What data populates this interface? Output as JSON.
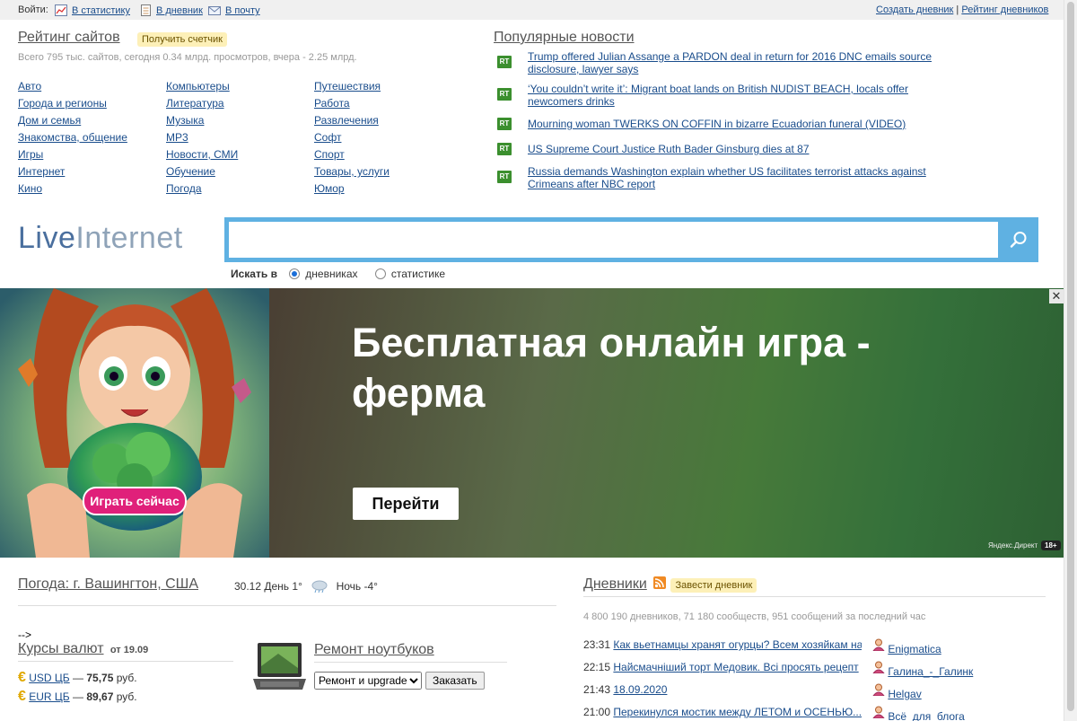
{
  "topbar": {
    "login": "Войти:",
    "stats": "В статистику",
    "diary": "В дневник",
    "mail": "В почту",
    "create": "Создать дневник",
    "sep": "|",
    "rating": "Рейтинг дневников"
  },
  "rating": {
    "title": "Рейтинг сайтов",
    "counter_btn": "Получить счетчик",
    "stats": "Всего 795 тыс. сайтов, сегодня 0.34 млрд. просмотров, вчера - 2.25 млрд.",
    "categories": [
      [
        "Авто",
        "Города и регионы",
        "Дом и семья",
        "Знакомства, общение",
        "Игры",
        "Интернет",
        "Кино"
      ],
      [
        "Компьютеры",
        "Литература",
        "Музыка",
        "MP3",
        "Новости, СМИ",
        "Обучение",
        "Погода"
      ],
      [
        "Путешествия",
        "Работа",
        "Развлечения",
        "Софт",
        "Спорт",
        "Товары, услуги",
        "Юмор"
      ]
    ]
  },
  "news": {
    "title": "Популярные новости",
    "source_label": "RT",
    "items": [
      "Trump offered Julian Assange a PARDON deal in return for 2016 DNC emails source disclosure, lawyer says",
      "‘You couldn’t write it’: Migrant boat lands on British NUDIST BEACH, locals offer newcomers drinks",
      "Mourning woman TWERKS ON COFFIN in bizarre Ecuadorian funeral (VIDEO)",
      "US Supreme Court Justice Ruth Bader Ginsburg dies at 87",
      "Russia demands Washington explain whether US facilitates terrorist attacks against Crimeans after NBC report"
    ]
  },
  "logo": {
    "part1": "Live",
    "part2": "Internet"
  },
  "search": {
    "value": "",
    "label": "Искать в",
    "option_diaries": "дневниках",
    "option_stats": "статистике",
    "selected": "дневниках"
  },
  "ad": {
    "title": "Бесплатная онлайн игра - ферма",
    "image_button": "Играть сейчас",
    "go_button": "Перейти",
    "close": "✕",
    "provider": "Яндекс.Директ",
    "age": "18+"
  },
  "weather": {
    "title": "Погода: г. Вашингтон, США",
    "date": "30.12",
    "day": "День 1°",
    "night": "Ночь -4°"
  },
  "stray_text": "-->",
  "rates": {
    "title": "Курсы валют",
    "date": "от 19.09",
    "items": [
      {
        "code": "USD ЦБ",
        "dash": "—",
        "value": "75,75",
        "unit": "руб."
      },
      {
        "code": "EUR ЦБ",
        "dash": "—",
        "value": "89,67",
        "unit": "руб."
      }
    ]
  },
  "repair": {
    "title": "Ремонт ноутбуков",
    "select_value": "Ремонт и upgrade",
    "order_button": "Заказать"
  },
  "diaries": {
    "title": "Дневники",
    "create_btn": "Завести дневник",
    "stats": "4 800 190 дневников, 71 180 сообществ, 951 сообщений за последний час",
    "posts": [
      {
        "time": "23:31",
        "title": "Как вьетнамцы хранят огурцы? Всем хозяйкам на",
        "user": "Enigmatica"
      },
      {
        "time": "22:15",
        "title": "Найсмачніший торт Медовик. Всі просять рецепт",
        "user": "Галина_-_Галинк"
      },
      {
        "time": "21:43",
        "title": "18.09.2020",
        "user": "Helgav"
      },
      {
        "time": "21:00",
        "title": "Перекинулся мостик между ЛЕТОМ и ОСЕНЬЮ...",
        "user": "Всё_для_блога"
      }
    ]
  }
}
